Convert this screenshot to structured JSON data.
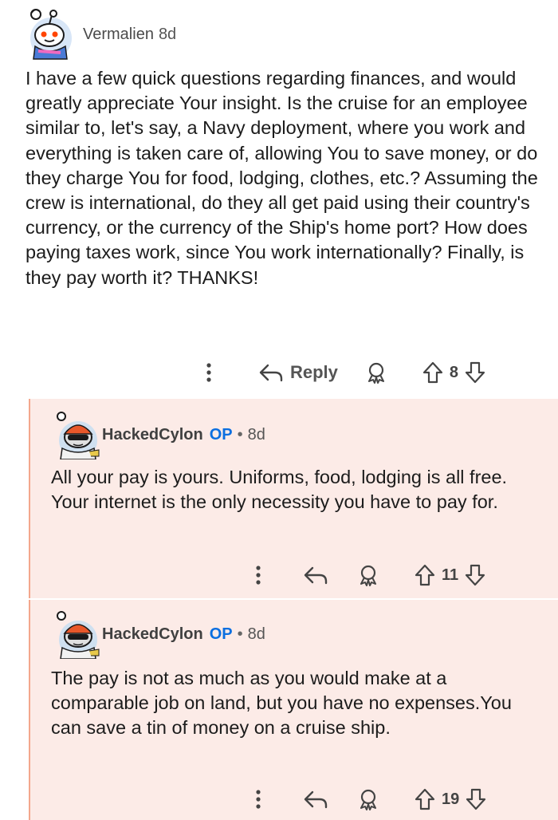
{
  "top_comment": {
    "username": "Vermalien",
    "time": "8d",
    "body": "I have a few quick questions regarding finances, and would greatly appreciate Your insight. Is the cruise for an employee similar to, let's say, a Navy deployment, where you work and everything is taken care of, allowing You to save money, or do they charge You for food, lodging, clothes, etc.? Assuming the crew is international, do they all get paid using their country's currency, or the currency of the Ship's home port? How does paying taxes work, since You work internationally? Finally, is they pay worth it? THANKS!",
    "reply_label": "Reply",
    "votes": "8"
  },
  "replies": [
    {
      "username": "HackedCylon",
      "badge": "OP",
      "separator": "•",
      "time": "8d",
      "body": "All your pay is yours. Uniforms, food, lodging is all free. Your internet is the only necessity you have to pay for.",
      "votes": "11"
    },
    {
      "username": "HackedCylon",
      "badge": "OP",
      "separator": "•",
      "time": "8d",
      "body": "The pay is not as much as you would make at a comparable job on land, but you have no expenses.You can save a tin of money on a cruise ship.",
      "votes": "19"
    }
  ],
  "icons": [
    "more-options-icon",
    "reply-arrow-icon",
    "award-icon",
    "upvote-icon",
    "downvote-icon",
    "snoo-avatar-icon"
  ],
  "colors": {
    "reply_background": "#fcebe7",
    "thread_line": "#f3a78c",
    "op_badge": "#0b6fe0",
    "avatar_orange": "#e8572a"
  }
}
